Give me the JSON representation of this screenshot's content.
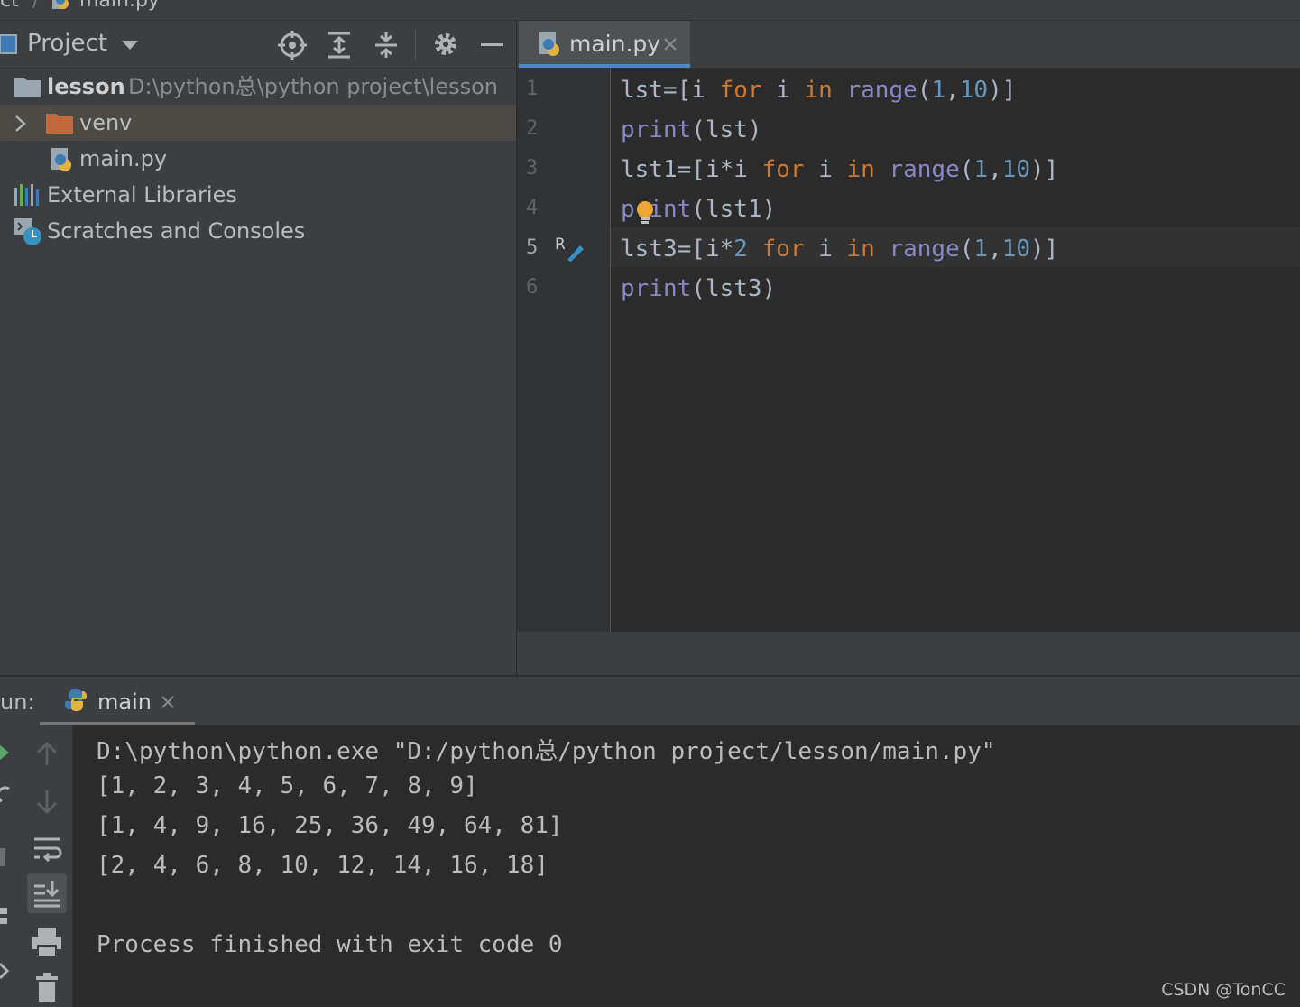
{
  "breadcrumb": {
    "path": "ct",
    "file": "main.py"
  },
  "project_panel": {
    "title": "Project",
    "tree": {
      "root_name": "lesson",
      "root_path": "D:\\python总\\python project\\lesson",
      "venv": "venv",
      "main_file": "main.py",
      "external_libraries": "External Libraries",
      "scratches": "Scratches and Consoles"
    }
  },
  "editor": {
    "tab_label": "main.py",
    "line_numbers": [
      "1",
      "2",
      "3",
      "4",
      "5",
      "6"
    ],
    "code_lines": [
      "lst=[i for i in range(1,10)]",
      "print(lst)",
      "lst1=[i*i for i in range(1,10)]",
      "print(lst1)",
      "lst3=[i*2 for i in range(1,10)]",
      "print(lst3)"
    ]
  },
  "run_panel": {
    "label": "un:",
    "tab": "main",
    "output": [
      "D:\\python\\python.exe \"D:/python总/python project/lesson/main.py\"",
      "[1, 2, 3, 4, 5, 6, 7, 8, 9]",
      "[1, 4, 9, 16, 25, 36, 49, 64, 81]",
      "[2, 4, 6, 8, 10, 12, 14, 16, 18]",
      "",
      "Process finished with exit code 0"
    ]
  },
  "watermark": "CSDN @TonCC",
  "colors": {
    "keyword": "#cc7832",
    "builtin": "#8888c6",
    "number": "#6897bb",
    "accent": "#4a88c7",
    "folder": "#c0693b"
  }
}
